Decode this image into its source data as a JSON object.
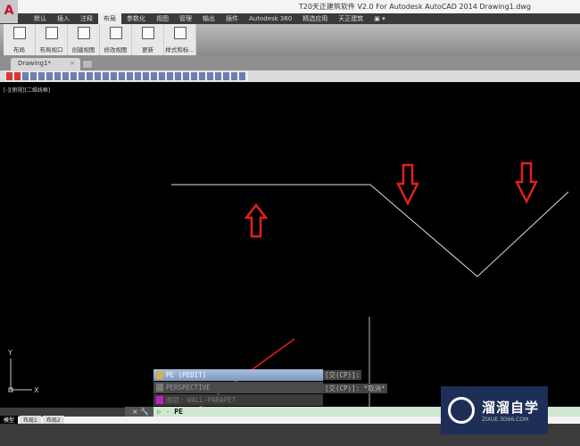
{
  "app": {
    "logo": "A",
    "title": "T20天正建筑软件 V2.0 For Autodesk AutoCAD 2014    Drawing1.dwg"
  },
  "ribbon_tabs": [
    "默认",
    "插入",
    "注释",
    "布局",
    "参数化",
    "视图",
    "管理",
    "输出",
    "插件",
    "Autodesk 360",
    "精选应用",
    "天正建筑",
    "▣ ▾"
  ],
  "ribbon_active": 3,
  "ribbon_buttons": [
    "布局",
    "布局视口",
    "创建视图",
    "修改视图",
    "更新",
    "样式和标..."
  ],
  "file_tab": {
    "label": "Drawing1*",
    "close": "×"
  },
  "viewport_label": "[-][俯视][二维线框]",
  "autocomplete": [
    {
      "label": "PE (PEDIT)",
      "color": "#d4b24a"
    },
    {
      "label": "PERSPECTIVE",
      "color": "#777777"
    },
    {
      "label": "图层: WALL-PARAPET",
      "color": "#c020c0"
    }
  ],
  "history": [
    "[交(CP)]:",
    "[交(CP)]: *取消*"
  ],
  "command": {
    "left": "× 🔧",
    "prompt": "▷ ·",
    "value": "PE"
  },
  "layout_tabs": [
    "模型",
    "布局1",
    "布局2"
  ],
  "ucs": {
    "x": "X",
    "y": "Y"
  },
  "watermark": {
    "name": "溜溜自学",
    "url": "ZIXUE.3D66.COM"
  },
  "annotation_color": "#e02020"
}
